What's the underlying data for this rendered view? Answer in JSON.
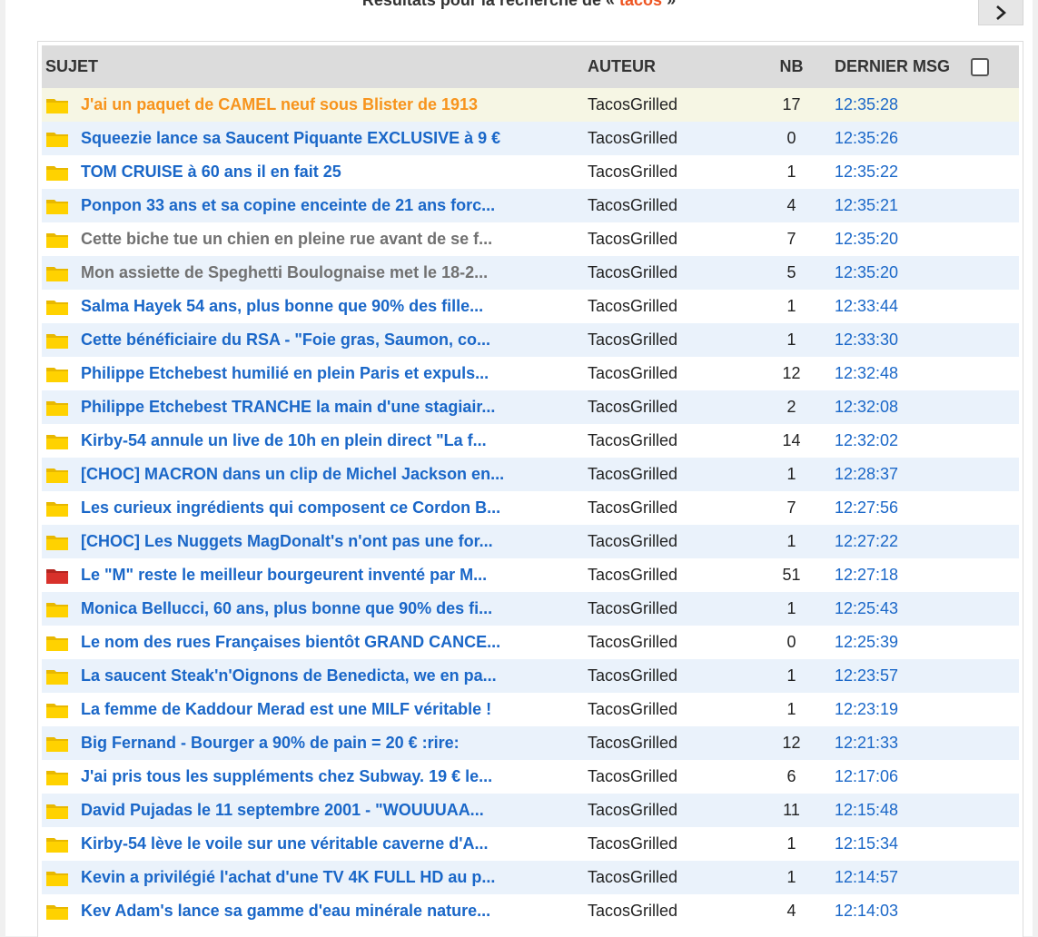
{
  "search": {
    "heading_prefix": "Résultats pour la recherche de «",
    "term": "tacos",
    "heading_suffix": "»"
  },
  "nav": {
    "next_icon": "chevron-right-icon"
  },
  "table": {
    "headers": {
      "subject": "SUJET",
      "author": "AUTEUR",
      "nb": "NB",
      "last_msg": "DERNIER MSG"
    },
    "folder_colors": {
      "default": "#ffd200",
      "hot": "#d8312b"
    },
    "rows": [
      {
        "title": "J'ai un paquet de CAMEL neuf sous Blister de 1913",
        "author": "TacosGrilled",
        "nb": "17",
        "time": "12:35:28",
        "state": "highlight",
        "icon": "folder-icon"
      },
      {
        "title": "Squeezie lance sa Saucent Piquante EXCLUSIVE à 9 €",
        "author": "TacosGrilled",
        "nb": "0",
        "time": "12:35:26",
        "state": "normal",
        "icon": "folder-icon"
      },
      {
        "title": "TOM CRUISE à 60 ans il en fait 25",
        "author": "TacosGrilled",
        "nb": "1",
        "time": "12:35:22",
        "state": "normal",
        "icon": "folder-icon"
      },
      {
        "title": "Ponpon 33 ans et sa copine enceinte de 21 ans forc...",
        "author": "TacosGrilled",
        "nb": "4",
        "time": "12:35:21",
        "state": "normal",
        "icon": "folder-icon"
      },
      {
        "title": "Cette biche tue un chien en pleine rue avant de se f...",
        "author": "TacosGrilled",
        "nb": "7",
        "time": "12:35:20",
        "state": "visited",
        "icon": "folder-icon"
      },
      {
        "title": "Mon assiette de Speghetti Boulognaise met le 18-2...",
        "author": "TacosGrilled",
        "nb": "5",
        "time": "12:35:20",
        "state": "visited",
        "icon": "folder-icon"
      },
      {
        "title": "Salma Hayek 54 ans, plus bonne que 90% des fille...",
        "author": "TacosGrilled",
        "nb": "1",
        "time": "12:33:44",
        "state": "normal",
        "icon": "folder-icon"
      },
      {
        "title": "Cette bénéficiaire du RSA - \"Foie gras, Saumon, co...",
        "author": "TacosGrilled",
        "nb": "1",
        "time": "12:33:30",
        "state": "normal",
        "icon": "folder-icon"
      },
      {
        "title": "Philippe Etchebest humilié en plein Paris et expuls...",
        "author": "TacosGrilled",
        "nb": "12",
        "time": "12:32:48",
        "state": "normal",
        "icon": "folder-icon"
      },
      {
        "title": "Philippe Etchebest TRANCHE la main d'une stagiair...",
        "author": "TacosGrilled",
        "nb": "2",
        "time": "12:32:08",
        "state": "normal",
        "icon": "folder-icon"
      },
      {
        "title": "Kirby-54 annule un live de 10h en plein direct \"La f...",
        "author": "TacosGrilled",
        "nb": "14",
        "time": "12:32:02",
        "state": "normal",
        "icon": "folder-icon"
      },
      {
        "title": "[CHOC] MACRON dans un clip de Michel Jackson en...",
        "author": "TacosGrilled",
        "nb": "1",
        "time": "12:28:37",
        "state": "normal",
        "icon": "folder-icon"
      },
      {
        "title": "Les curieux ingrédients qui composent ce Cordon B...",
        "author": "TacosGrilled",
        "nb": "7",
        "time": "12:27:56",
        "state": "normal",
        "icon": "folder-icon"
      },
      {
        "title": "[CHOC] Les Nuggets MagDonalt's n'ont pas une for...",
        "author": "TacosGrilled",
        "nb": "1",
        "time": "12:27:22",
        "state": "normal",
        "icon": "folder-icon"
      },
      {
        "title": "Le \"M\" reste le meilleur bourgeurent inventé par M...",
        "author": "TacosGrilled",
        "nb": "51",
        "time": "12:27:18",
        "state": "normal",
        "icon": "hot-folder-icon"
      },
      {
        "title": "Monica Bellucci, 60 ans, plus bonne que 90% des fi...",
        "author": "TacosGrilled",
        "nb": "1",
        "time": "12:25:43",
        "state": "normal",
        "icon": "folder-icon"
      },
      {
        "title": "Le nom des rues Françaises bientôt GRAND CANCE...",
        "author": "TacosGrilled",
        "nb": "0",
        "time": "12:25:39",
        "state": "normal",
        "icon": "folder-icon"
      },
      {
        "title": "La saucent Steak'n'Oignons de Benedicta, we en pa...",
        "author": "TacosGrilled",
        "nb": "1",
        "time": "12:23:57",
        "state": "normal",
        "icon": "folder-icon"
      },
      {
        "title": "La femme de Kaddour Merad est une MILF véritable !",
        "author": "TacosGrilled",
        "nb": "1",
        "time": "12:23:19",
        "state": "normal",
        "icon": "folder-icon"
      },
      {
        "title": "Big Fernand - Bourger a 90% de pain = 20 € :rire:",
        "author": "TacosGrilled",
        "nb": "12",
        "time": "12:21:33",
        "state": "normal",
        "icon": "folder-icon"
      },
      {
        "title": "J'ai pris tous les suppléments chez Subway. 19 € le...",
        "author": "TacosGrilled",
        "nb": "6",
        "time": "12:17:06",
        "state": "normal",
        "icon": "folder-icon"
      },
      {
        "title": "David Pujadas le 11 septembre 2001 - \"WOUUUAA...",
        "author": "TacosGrilled",
        "nb": "11",
        "time": "12:15:48",
        "state": "normal",
        "icon": "folder-icon"
      },
      {
        "title": "Kirby-54 lève le voile sur une véritable caverne d'A...",
        "author": "TacosGrilled",
        "nb": "1",
        "time": "12:15:34",
        "state": "normal",
        "icon": "folder-icon"
      },
      {
        "title": "Kevin a privilégié l'achat d'une TV 4K FULL HD au p...",
        "author": "TacosGrilled",
        "nb": "1",
        "time": "12:14:57",
        "state": "normal",
        "icon": "folder-icon"
      },
      {
        "title": "Kev Adam's lance sa gamme d'eau minérale nature...",
        "author": "TacosGrilled",
        "nb": "4",
        "time": "12:14:03",
        "state": "normal",
        "icon": "folder-icon"
      }
    ]
  }
}
